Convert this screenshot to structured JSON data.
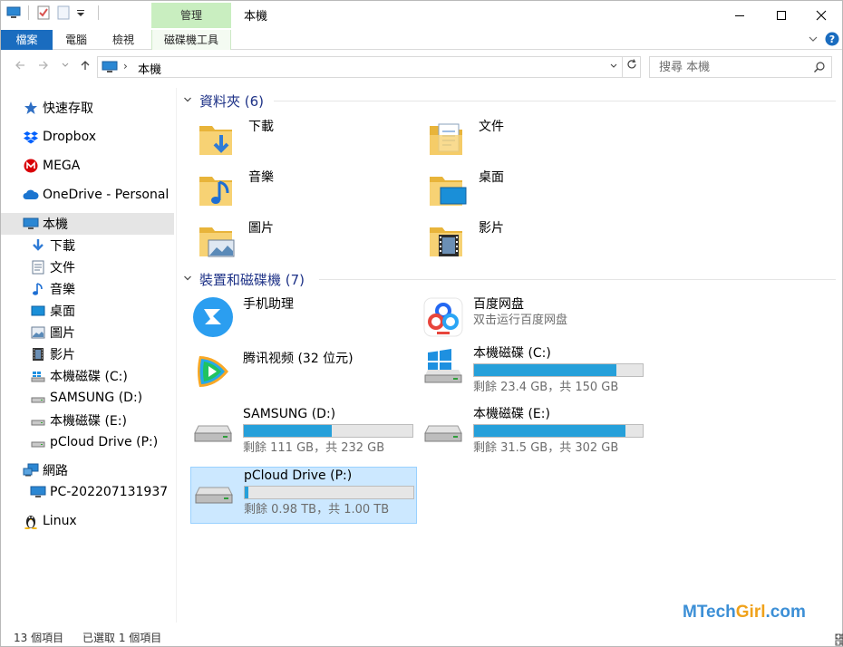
{
  "window": {
    "title": "本機",
    "context_tab_group": "管理"
  },
  "ribbon": {
    "tabs": [
      {
        "label": "檔案"
      },
      {
        "label": "電腦"
      },
      {
        "label": "檢視"
      },
      {
        "label": "磁碟機工具"
      }
    ]
  },
  "address": {
    "path": "本機",
    "search_placeholder": "搜尋 本機"
  },
  "sidebar": {
    "items": [
      {
        "label": "快速存取",
        "icon": "star-icon"
      },
      {
        "label": "Dropbox",
        "icon": "dropbox-icon"
      },
      {
        "label": "MEGA",
        "icon": "mega-icon"
      },
      {
        "label": "OneDrive - Personal",
        "icon": "cloud-icon"
      },
      {
        "label": "本機",
        "icon": "pc-icon"
      },
      {
        "label": "下載",
        "icon": "download-icon"
      },
      {
        "label": "文件",
        "icon": "document-icon"
      },
      {
        "label": "音樂",
        "icon": "music-icon"
      },
      {
        "label": "桌面",
        "icon": "desktop-icon"
      },
      {
        "label": "圖片",
        "icon": "picture-icon"
      },
      {
        "label": "影片",
        "icon": "video-icon"
      },
      {
        "label": "本機磁碟 (C:)",
        "icon": "drive-icon"
      },
      {
        "label": "SAMSUNG (D:)",
        "icon": "drive-icon"
      },
      {
        "label": "本機磁碟 (E:)",
        "icon": "drive-icon"
      },
      {
        "label": "pCloud Drive (P:)",
        "icon": "drive-icon"
      },
      {
        "label": "網路",
        "icon": "network-icon"
      },
      {
        "label": "PC-202207131937",
        "icon": "pc-icon"
      },
      {
        "label": "Linux",
        "icon": "linux-icon"
      }
    ]
  },
  "content": {
    "folders_header": "資料夾 (6)",
    "folders": [
      {
        "label": "下載",
        "icon": "download-folder-icon"
      },
      {
        "label": "文件",
        "icon": "documents-folder-icon"
      },
      {
        "label": "音樂",
        "icon": "music-folder-icon"
      },
      {
        "label": "桌面",
        "icon": "desktop-folder-icon"
      },
      {
        "label": "圖片",
        "icon": "pictures-folder-icon"
      },
      {
        "label": "影片",
        "icon": "videos-folder-icon"
      }
    ],
    "devices_header": "裝置和磁碟機 (7)",
    "devices": [
      {
        "label": "手机助理",
        "sub": "",
        "icon": "phone-assistant-icon"
      },
      {
        "label": "百度网盘",
        "sub": "双击运行百度网盘",
        "icon": "baidu-netdisk-icon"
      },
      {
        "label": "腾讯视频 (32 位元)",
        "sub": "",
        "icon": "tencent-video-icon"
      },
      {
        "label": "本機磁碟 (C:)",
        "sub": "剩餘 23.4 GB，共 150 GB",
        "used_fraction": 0.844,
        "icon": "windows-drive-icon"
      },
      {
        "label": "SAMSUNG (D:)",
        "sub": "剩餘 111 GB，共 232 GB",
        "used_fraction": 0.522,
        "icon": "drive-icon"
      },
      {
        "label": "本機磁碟 (E:)",
        "sub": "剩餘 31.5 GB，共 302 GB",
        "used_fraction": 0.896,
        "icon": "drive-icon"
      },
      {
        "label": "pCloud Drive (P:)",
        "sub": "剩餘 0.98 TB，共 1.00 TB",
        "used_fraction": 0.02,
        "icon": "drive-icon"
      }
    ]
  },
  "status": {
    "items_count": "13 個項目",
    "selected": "已選取 1 個項目"
  },
  "watermark": {
    "text_a": "M",
    "text_b": "Tech",
    "text_c": "Girl",
    "text_d": ".com"
  },
  "colors": {
    "accent": "#1a6cbf",
    "bar_fill": "#26a0da",
    "selection": "#cce8ff",
    "header_text": "#1e3287"
  }
}
